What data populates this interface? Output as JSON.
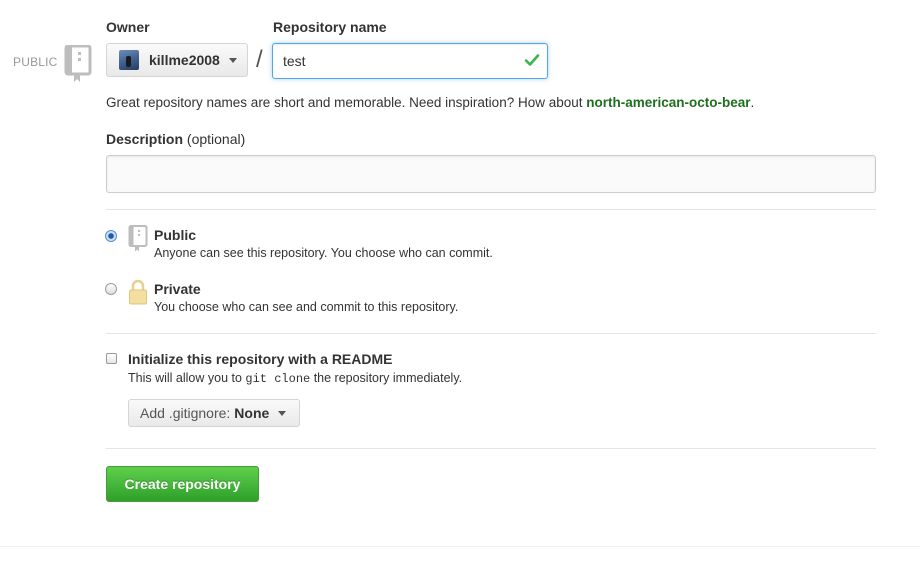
{
  "visibility_tag": "PUBLIC",
  "owner": {
    "label": "Owner",
    "name": "killme2008"
  },
  "repository": {
    "label": "Repository name",
    "value": "test"
  },
  "hint": {
    "prefix": "Great repository names are short and memorable. Need inspiration? How about ",
    "suggestion": "north-american-octo-bear",
    "suffix": "."
  },
  "description": {
    "label": "Description",
    "optional": "(optional)",
    "value": ""
  },
  "visibility": {
    "public": {
      "title": "Public",
      "desc": "Anyone can see this repository. You choose who can commit.",
      "checked": true
    },
    "private": {
      "title": "Private",
      "desc": "You choose who can see and commit to this repository.",
      "checked": false
    }
  },
  "readme": {
    "title": "Initialize this repository with a README",
    "desc_prefix": "This will allow you to ",
    "desc_code": "git clone",
    "desc_suffix": " the repository immediately.",
    "checked": false
  },
  "gitignore": {
    "label": "Add .gitignore:",
    "value": "None"
  },
  "create_button": "Create repository",
  "colors": {
    "accent_green": "#2ea02a",
    "focus_blue": "#51a7e8",
    "link_green": "#1d6f1d",
    "check_green": "#39b54a"
  },
  "icons": [
    "repo-icon",
    "checkmark-icon",
    "chevron-down-icon",
    "lock-icon"
  ]
}
